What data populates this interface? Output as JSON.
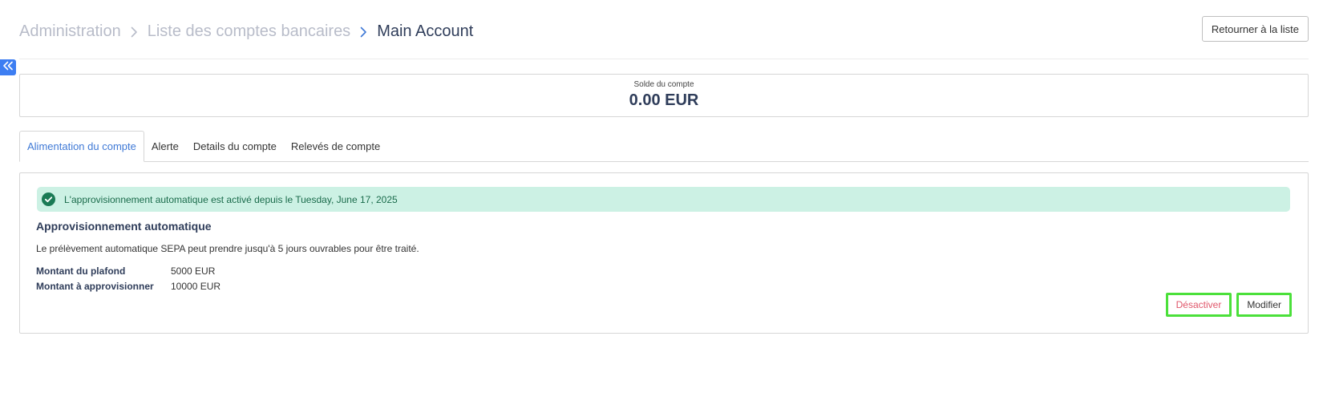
{
  "breadcrumb": {
    "items": [
      "Administration",
      "Liste des comptes bancaires"
    ],
    "current": "Main Account"
  },
  "header": {
    "back_button": "Retourner à la liste"
  },
  "balance": {
    "label": "Solde du compte",
    "amount": "0.00 EUR"
  },
  "tabs": [
    {
      "label": "Alimentation du compte",
      "active": true
    },
    {
      "label": "Alerte",
      "active": false
    },
    {
      "label": "Details du compte",
      "active": false
    },
    {
      "label": "Relevés de compte",
      "active": false
    }
  ],
  "panel": {
    "alert_text": "L'approvisionnement automatique est activé depuis le Tuesday, June 17, 2025",
    "title": "Approvisionnement automatique",
    "description": "Le prélèvement automatique SEPA peut prendre jusqu'à 5 jours ouvrables pour être traité.",
    "rows": [
      {
        "label": "Montant du plafond",
        "value": "5000 EUR"
      },
      {
        "label": "Montant à approvisionner",
        "value": "10000 EUR"
      }
    ],
    "deactivate_button": "Désactiver",
    "edit_button": "Modifier"
  },
  "colors": {
    "accent": "#3f79d6",
    "toggle": "#3d7ef2",
    "alert_bg": "#ccf1e4",
    "alert_icon": "#1a7a55",
    "danger": "#e0566a",
    "highlight_border": "#4be03a"
  },
  "icons": {
    "breadcrumb_separator": "chevron-right-icon",
    "collapse": "double-chevron-left-icon",
    "alert": "check-circle-icon"
  }
}
